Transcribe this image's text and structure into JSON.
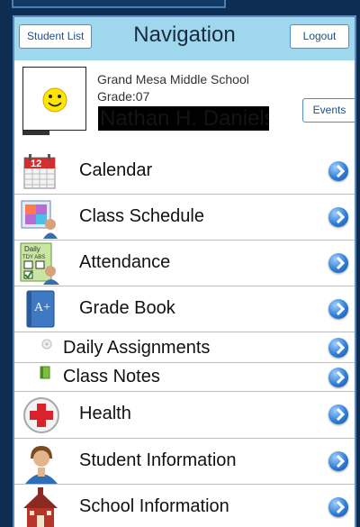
{
  "header": {
    "title": "Navigation",
    "student_list_label": "Student List",
    "logout_label": "Logout"
  },
  "profile": {
    "school": "Grand Mesa Middle School",
    "grade": "Grade:07",
    "student_name": "Nathan H. Daniels",
    "events_label": "Events",
    "avatar_icon": "smiley-face-icon"
  },
  "menu": [
    {
      "label": "Calendar",
      "icon": "calendar-icon"
    },
    {
      "label": "Class Schedule",
      "icon": "class-schedule-icon"
    },
    {
      "label": "Attendance",
      "icon": "attendance-icon"
    },
    {
      "label": "Grade Book",
      "icon": "grade-book-icon"
    },
    {
      "label": "Daily Assignments",
      "icon": "daily-assignments-icon"
    },
    {
      "label": "Class Notes",
      "icon": "class-notes-icon"
    },
    {
      "label": "Health",
      "icon": "health-cross-icon"
    },
    {
      "label": "Student Information",
      "icon": "student-information-icon"
    },
    {
      "label": "School Information",
      "icon": "school-building-icon"
    }
  ],
  "colors": {
    "background": "#0d2e52",
    "header": "#9fd7ee",
    "button_border": "#4f8fd0",
    "chevron": "#2e7fd8"
  }
}
